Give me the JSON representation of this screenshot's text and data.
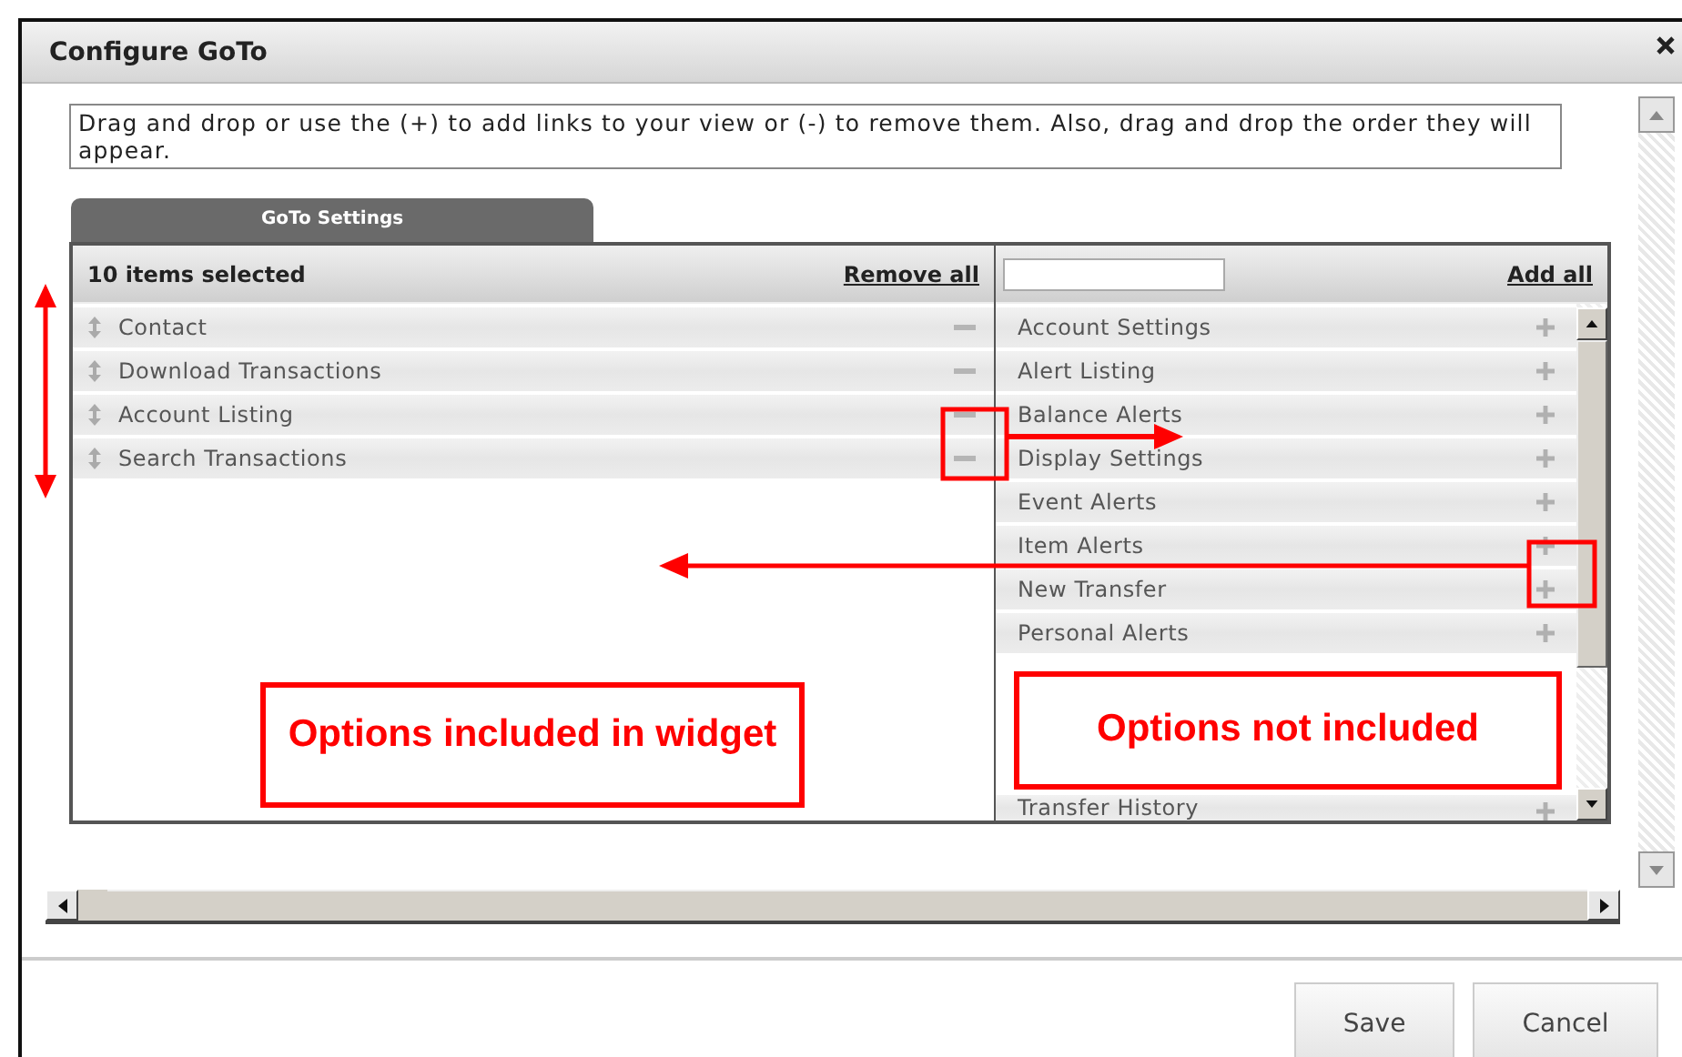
{
  "window": {
    "title": "Configure GoTo"
  },
  "instructions": "Drag and drop or use the (+) to add links to your view or (-) to remove them. Also, drag and drop the order they will appear.",
  "tabs": [
    {
      "label": "GoTo Settings",
      "selected": true
    }
  ],
  "selected_panel": {
    "count_label": "10 items selected",
    "action": "Remove all",
    "items": [
      {
        "label": "Contact"
      },
      {
        "label": "Download Transactions"
      },
      {
        "label": "Account Listing"
      },
      {
        "label": "Search Transactions"
      }
    ]
  },
  "available_panel": {
    "action": "Add all",
    "items": [
      {
        "label": "Account Settings"
      },
      {
        "label": "Alert Listing"
      },
      {
        "label": "Balance Alerts"
      },
      {
        "label": "Display Settings"
      },
      {
        "label": "Event Alerts"
      },
      {
        "label": "Item Alerts"
      },
      {
        "label": "New Transfer"
      },
      {
        "label": "Personal Alerts"
      },
      {
        "label": "Transfer History"
      }
    ]
  },
  "annotations": [
    {
      "text": "Options included in widget"
    },
    {
      "text": "Options not included"
    }
  ],
  "buttons": [
    "Save",
    "Cancel"
  ]
}
